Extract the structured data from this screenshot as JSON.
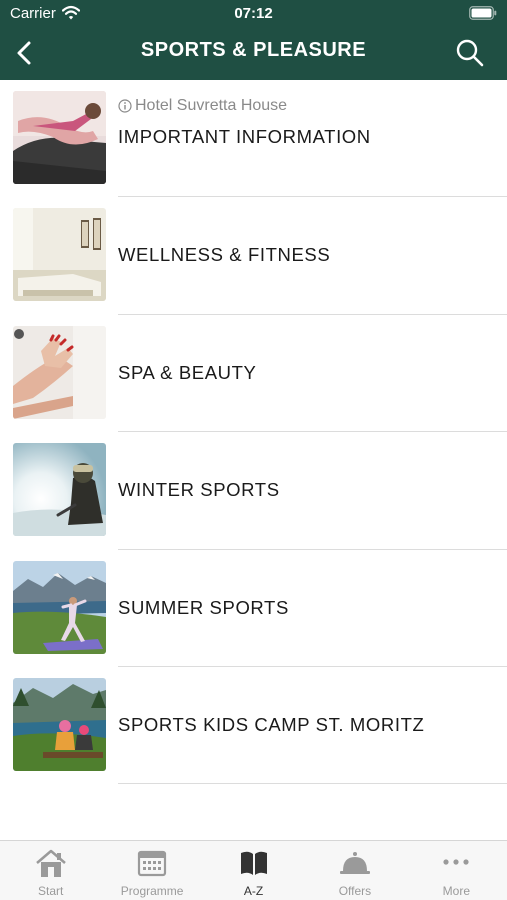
{
  "status_bar": {
    "carrier": "Carrier",
    "time": "07:12"
  },
  "nav": {
    "title": "SPORTS & PLEASURE",
    "back_icon": "chevron-left-icon",
    "search_icon": "search-icon"
  },
  "colors": {
    "header_bg": "#1f4f43",
    "active_tab": "#333333",
    "inactive_tab": "#9a9a9a"
  },
  "items": [
    {
      "label": "IMPORTANT INFORMATION",
      "subtitle": "Hotel Suvretta House",
      "image": "yoga-stretch-photo"
    },
    {
      "label": "WELLNESS & FITNESS",
      "image": "treatment-room-photo"
    },
    {
      "label": "SPA & BEAUTY",
      "image": "hand-massage-photo"
    },
    {
      "label": "WINTER SPORTS",
      "image": "skier-sunlight-photo"
    },
    {
      "label": "SUMMER SPORTS",
      "image": "mountain-yoga-photo"
    },
    {
      "label": "SPORTS KIDS CAMP ST. MORITZ",
      "image": "kids-lake-photo"
    }
  ],
  "tabs": [
    {
      "label": "Start",
      "icon": "home-icon"
    },
    {
      "label": "Programme",
      "icon": "calendar-icon"
    },
    {
      "label": "A-Z",
      "icon": "book-icon",
      "active": true
    },
    {
      "label": "Offers",
      "icon": "service-bell-icon"
    },
    {
      "label": "More",
      "icon": "more-dots-icon"
    }
  ]
}
